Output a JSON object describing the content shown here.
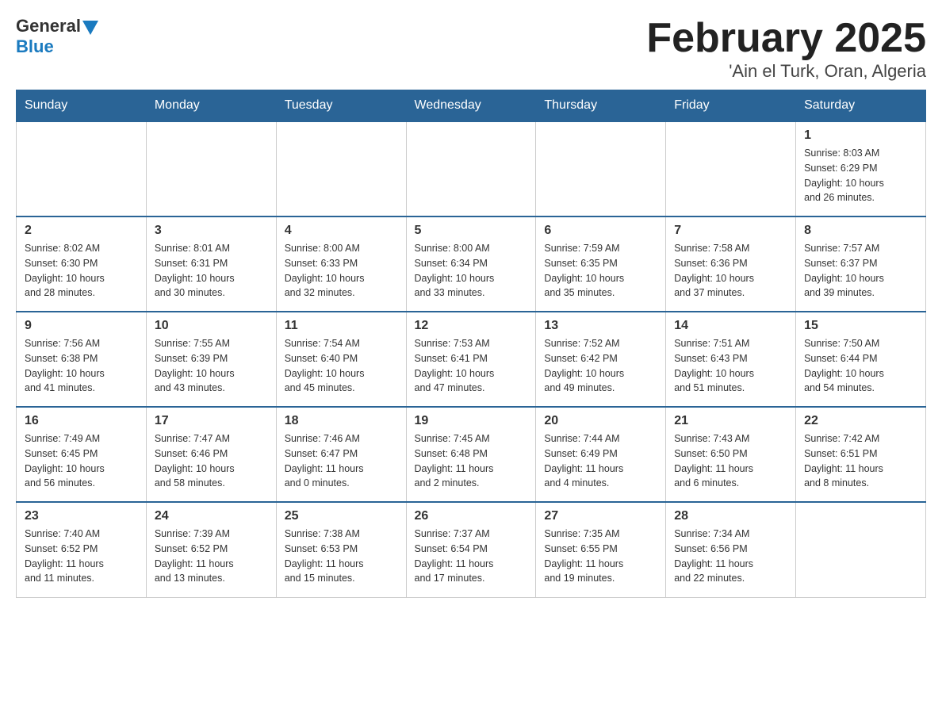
{
  "header": {
    "logo_general": "General",
    "logo_blue": "Blue",
    "month_title": "February 2025",
    "subtitle": "'Ain el Turk, Oran, Algeria"
  },
  "weekdays": [
    "Sunday",
    "Monday",
    "Tuesday",
    "Wednesday",
    "Thursday",
    "Friday",
    "Saturday"
  ],
  "weeks": [
    [
      {
        "day": "",
        "info": ""
      },
      {
        "day": "",
        "info": ""
      },
      {
        "day": "",
        "info": ""
      },
      {
        "day": "",
        "info": ""
      },
      {
        "day": "",
        "info": ""
      },
      {
        "day": "",
        "info": ""
      },
      {
        "day": "1",
        "info": "Sunrise: 8:03 AM\nSunset: 6:29 PM\nDaylight: 10 hours\nand 26 minutes."
      }
    ],
    [
      {
        "day": "2",
        "info": "Sunrise: 8:02 AM\nSunset: 6:30 PM\nDaylight: 10 hours\nand 28 minutes."
      },
      {
        "day": "3",
        "info": "Sunrise: 8:01 AM\nSunset: 6:31 PM\nDaylight: 10 hours\nand 30 minutes."
      },
      {
        "day": "4",
        "info": "Sunrise: 8:00 AM\nSunset: 6:33 PM\nDaylight: 10 hours\nand 32 minutes."
      },
      {
        "day": "5",
        "info": "Sunrise: 8:00 AM\nSunset: 6:34 PM\nDaylight: 10 hours\nand 33 minutes."
      },
      {
        "day": "6",
        "info": "Sunrise: 7:59 AM\nSunset: 6:35 PM\nDaylight: 10 hours\nand 35 minutes."
      },
      {
        "day": "7",
        "info": "Sunrise: 7:58 AM\nSunset: 6:36 PM\nDaylight: 10 hours\nand 37 minutes."
      },
      {
        "day": "8",
        "info": "Sunrise: 7:57 AM\nSunset: 6:37 PM\nDaylight: 10 hours\nand 39 minutes."
      }
    ],
    [
      {
        "day": "9",
        "info": "Sunrise: 7:56 AM\nSunset: 6:38 PM\nDaylight: 10 hours\nand 41 minutes."
      },
      {
        "day": "10",
        "info": "Sunrise: 7:55 AM\nSunset: 6:39 PM\nDaylight: 10 hours\nand 43 minutes."
      },
      {
        "day": "11",
        "info": "Sunrise: 7:54 AM\nSunset: 6:40 PM\nDaylight: 10 hours\nand 45 minutes."
      },
      {
        "day": "12",
        "info": "Sunrise: 7:53 AM\nSunset: 6:41 PM\nDaylight: 10 hours\nand 47 minutes."
      },
      {
        "day": "13",
        "info": "Sunrise: 7:52 AM\nSunset: 6:42 PM\nDaylight: 10 hours\nand 49 minutes."
      },
      {
        "day": "14",
        "info": "Sunrise: 7:51 AM\nSunset: 6:43 PM\nDaylight: 10 hours\nand 51 minutes."
      },
      {
        "day": "15",
        "info": "Sunrise: 7:50 AM\nSunset: 6:44 PM\nDaylight: 10 hours\nand 54 minutes."
      }
    ],
    [
      {
        "day": "16",
        "info": "Sunrise: 7:49 AM\nSunset: 6:45 PM\nDaylight: 10 hours\nand 56 minutes."
      },
      {
        "day": "17",
        "info": "Sunrise: 7:47 AM\nSunset: 6:46 PM\nDaylight: 10 hours\nand 58 minutes."
      },
      {
        "day": "18",
        "info": "Sunrise: 7:46 AM\nSunset: 6:47 PM\nDaylight: 11 hours\nand 0 minutes."
      },
      {
        "day": "19",
        "info": "Sunrise: 7:45 AM\nSunset: 6:48 PM\nDaylight: 11 hours\nand 2 minutes."
      },
      {
        "day": "20",
        "info": "Sunrise: 7:44 AM\nSunset: 6:49 PM\nDaylight: 11 hours\nand 4 minutes."
      },
      {
        "day": "21",
        "info": "Sunrise: 7:43 AM\nSunset: 6:50 PM\nDaylight: 11 hours\nand 6 minutes."
      },
      {
        "day": "22",
        "info": "Sunrise: 7:42 AM\nSunset: 6:51 PM\nDaylight: 11 hours\nand 8 minutes."
      }
    ],
    [
      {
        "day": "23",
        "info": "Sunrise: 7:40 AM\nSunset: 6:52 PM\nDaylight: 11 hours\nand 11 minutes."
      },
      {
        "day": "24",
        "info": "Sunrise: 7:39 AM\nSunset: 6:52 PM\nDaylight: 11 hours\nand 13 minutes."
      },
      {
        "day": "25",
        "info": "Sunrise: 7:38 AM\nSunset: 6:53 PM\nDaylight: 11 hours\nand 15 minutes."
      },
      {
        "day": "26",
        "info": "Sunrise: 7:37 AM\nSunset: 6:54 PM\nDaylight: 11 hours\nand 17 minutes."
      },
      {
        "day": "27",
        "info": "Sunrise: 7:35 AM\nSunset: 6:55 PM\nDaylight: 11 hours\nand 19 minutes."
      },
      {
        "day": "28",
        "info": "Sunrise: 7:34 AM\nSunset: 6:56 PM\nDaylight: 11 hours\nand 22 minutes."
      },
      {
        "day": "",
        "info": ""
      }
    ]
  ]
}
